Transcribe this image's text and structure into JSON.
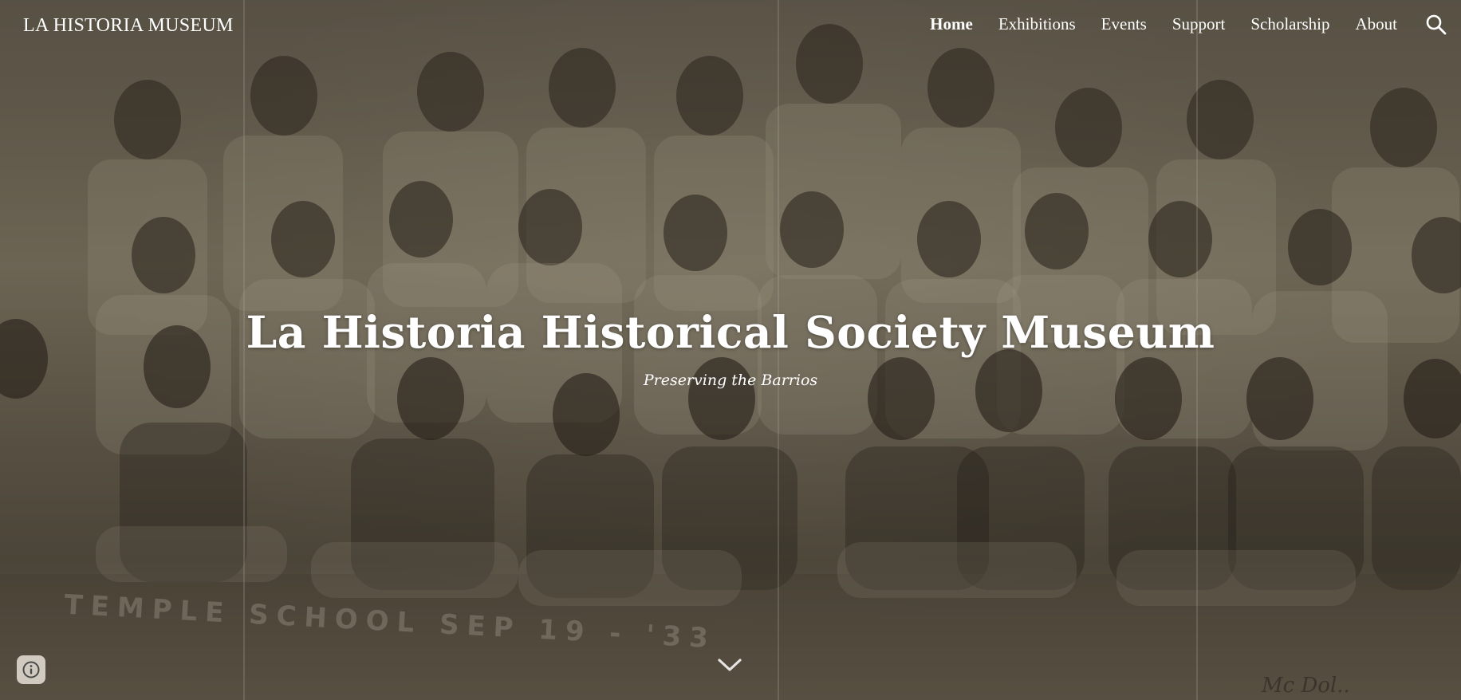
{
  "header": {
    "site_title": "LA HISTORIA MUSEUM",
    "nav": [
      {
        "label": "Home",
        "active": true
      },
      {
        "label": "Exhibitions",
        "active": false
      },
      {
        "label": "Events",
        "active": false
      },
      {
        "label": "Support",
        "active": false
      },
      {
        "label": "Scholarship",
        "active": false
      },
      {
        "label": "About",
        "active": false
      }
    ],
    "search_icon": "search-icon"
  },
  "hero": {
    "title": "La Historia Historical Society Museum",
    "subtitle": "Preserving the Barrios",
    "photo_caption": "TEMPLE SCHOOL SEP 19 - '33",
    "photo_signature": "Mc Dol..",
    "scroll_icon": "chevron-down-icon"
  },
  "footer": {
    "info_icon": "info-icon"
  },
  "colors": {
    "text": "#ffffff",
    "photo_tone": "#7a725f"
  }
}
